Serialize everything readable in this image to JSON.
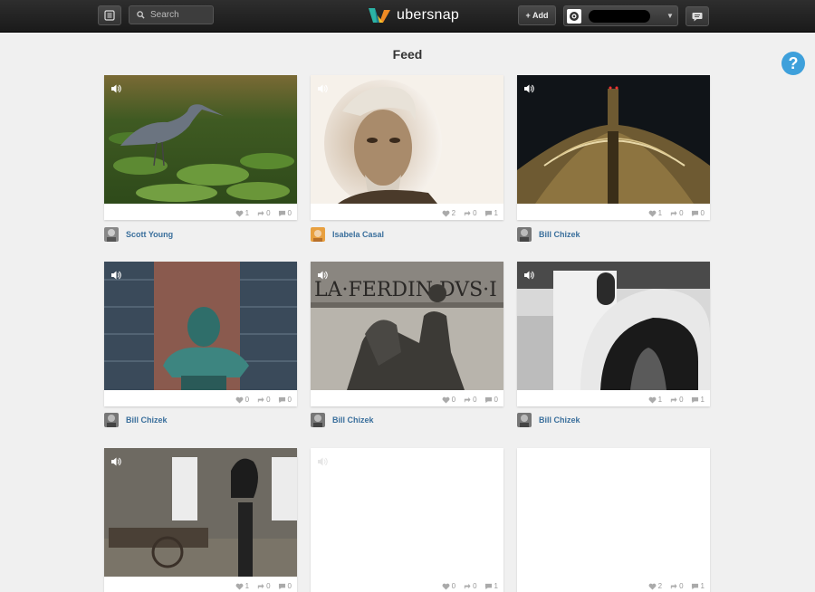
{
  "header": {
    "search_placeholder": "Search",
    "logo_text": "ubersnap",
    "add_label": "+ Add"
  },
  "help_label": "?",
  "page_title": "Feed",
  "feed": [
    {
      "likes": "1",
      "shares": "0",
      "comments": "0",
      "author": "Scott Young"
    },
    {
      "likes": "2",
      "shares": "0",
      "comments": "1",
      "author": "Isabela Casal"
    },
    {
      "likes": "1",
      "shares": "0",
      "comments": "0",
      "author": "Bill Chizek"
    },
    {
      "likes": "0",
      "shares": "0",
      "comments": "0",
      "author": "Bill Chizek"
    },
    {
      "likes": "0",
      "shares": "0",
      "comments": "0",
      "author": "Bill Chizek"
    },
    {
      "likes": "1",
      "shares": "0",
      "comments": "1",
      "author": "Bill Chizek"
    },
    {
      "likes": "1",
      "shares": "0",
      "comments": "0"
    },
    {
      "likes": "0",
      "shares": "0",
      "comments": "1"
    },
    {
      "likes": "2",
      "shares": "0",
      "comments": "1"
    }
  ],
  "colors": {
    "link": "#3a6f9c",
    "help": "#3ea0db",
    "topbar": "#222222"
  }
}
